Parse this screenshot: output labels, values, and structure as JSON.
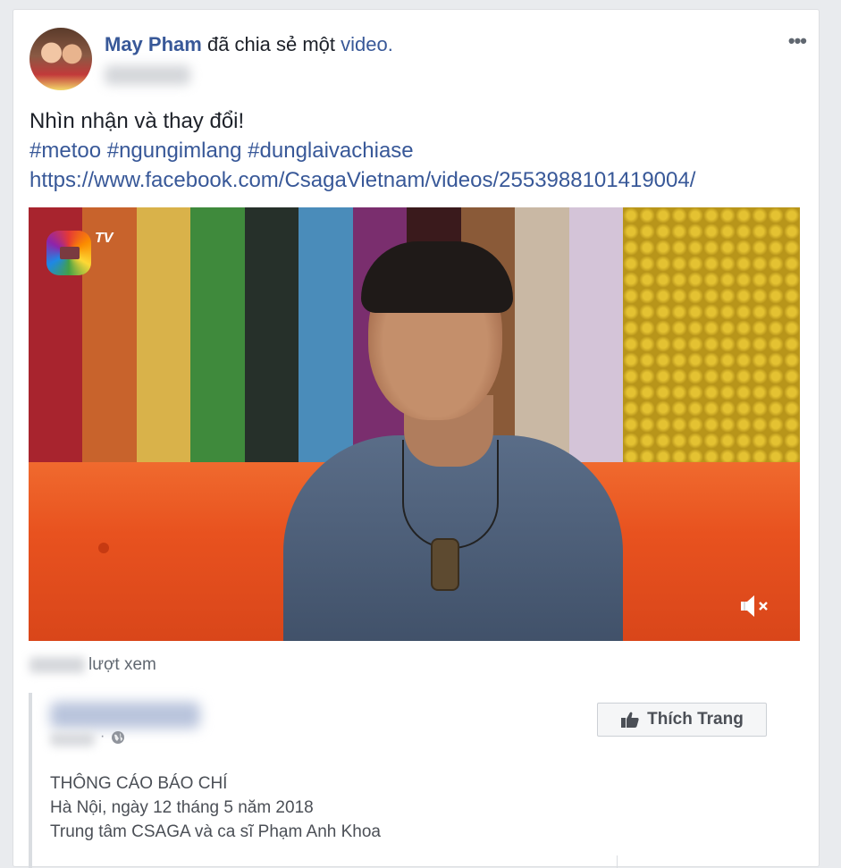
{
  "post": {
    "author": "May Pham",
    "action_text": "đã chia sẻ một",
    "video_word": "video.",
    "more_label": "•••",
    "text_line1": "Nhìn nhận và thay đổi!",
    "hashtags": "#metoo #ngungimlang #dunglaivachiase",
    "link": "https://www.facebook.com/CsagaVietnam/videos/2553988101419004/"
  },
  "video": {
    "channel_badge": "TV",
    "mute_icon": "speaker-muted-icon"
  },
  "views": {
    "label": "lượt xem"
  },
  "shared": {
    "like_page_label": "Thích Trang",
    "dot": "·",
    "text_lines": [
      "THÔNG CÁO BÁO CHÍ",
      "Hà Nội, ngày 12 tháng 5 năm 2018",
      "Trung tâm CSAGA và ca sĩ Phạm Anh Khoa"
    ]
  },
  "colors": {
    "link_blue": "#385898",
    "text": "#1d2129",
    "meta": "#606770"
  }
}
